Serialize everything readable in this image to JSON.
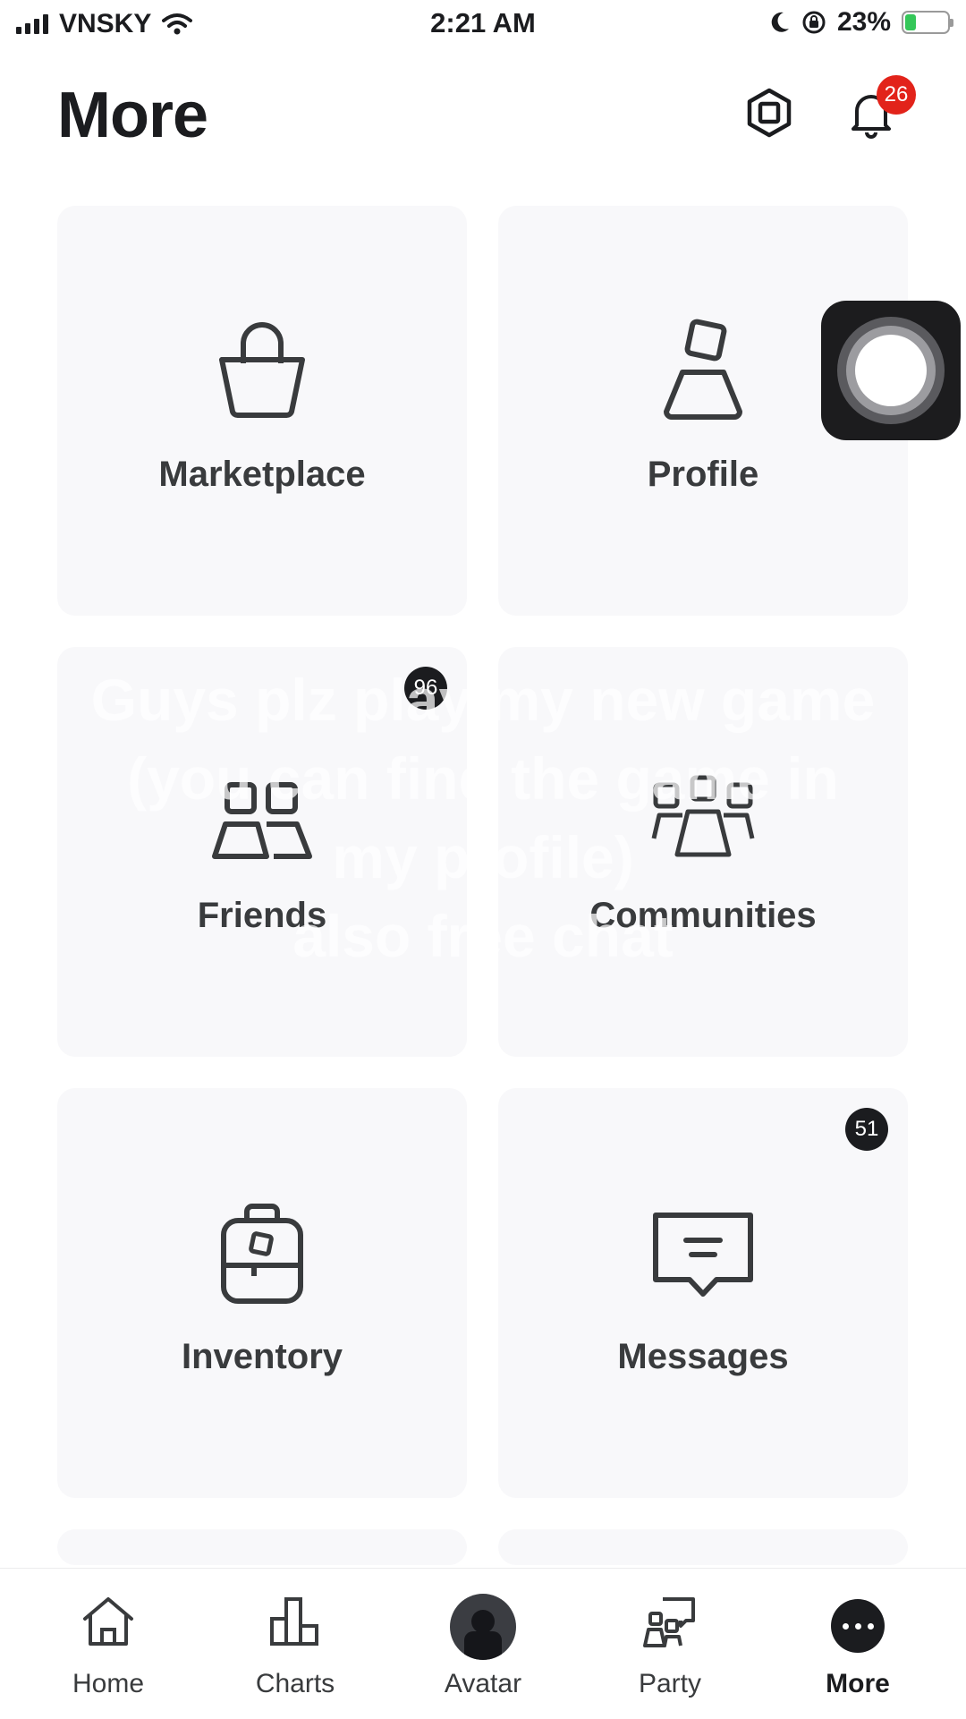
{
  "status_bar": {
    "carrier": "VNSKY",
    "time": "2:21 AM",
    "battery": "23%",
    "battery_level": 0.23
  },
  "header": {
    "title": "More",
    "notifications_count": "26"
  },
  "tiles": [
    {
      "label": "Marketplace",
      "icon": "shopping-bag-icon"
    },
    {
      "label": "Profile",
      "icon": "profile-icon"
    },
    {
      "label": "Friends",
      "icon": "friends-icon",
      "badge": "96"
    },
    {
      "label": "Communities",
      "icon": "communities-icon"
    },
    {
      "label": "Inventory",
      "icon": "backpack-icon"
    },
    {
      "label": "Messages",
      "icon": "message-icon",
      "badge": "51"
    }
  ],
  "overlay_caption": {
    "lines": [
      "Guys plz play my new game",
      "(you can find the game in",
      "my profile)",
      "also free chat"
    ]
  },
  "nav": [
    {
      "label": "Home",
      "icon": "home-icon"
    },
    {
      "label": "Charts",
      "icon": "charts-icon"
    },
    {
      "label": "Avatar",
      "icon": "avatar-icon"
    },
    {
      "label": "Party",
      "icon": "party-icon"
    },
    {
      "label": "More",
      "icon": "more-icon",
      "active": true
    }
  ],
  "colors": {
    "badge_red": "#e2231a",
    "tile_bg": "#f8f8fa",
    "icon_stroke": "#393b3d"
  }
}
